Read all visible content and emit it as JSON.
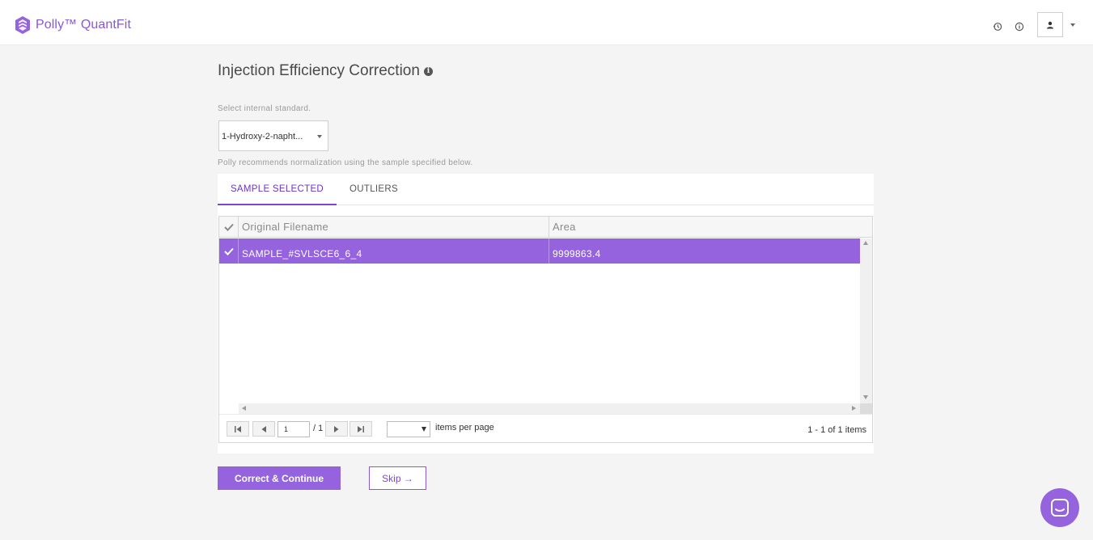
{
  "header": {
    "brand_name": "Polly™ QuantFit",
    "icons": [
      "history-icon",
      "info-icon",
      "user-icon",
      "chevron-down-icon"
    ],
    "accent_color": "#9463dd"
  },
  "page": {
    "title": "Injection Efficiency Correction",
    "title_icon": "info-icon",
    "select_label": "Select internal standard.",
    "selected_standard": "1-Hydroxy-2-napht...",
    "recommendation_text": "Polly recommends normalization using the sample specified below."
  },
  "tabs": [
    {
      "label": "SAMPLE SELECTED",
      "active": true
    },
    {
      "label": "OUTLIERS",
      "active": false
    }
  ],
  "grid": {
    "columns": [
      "Original Filename",
      "Area"
    ],
    "rows": [
      {
        "selected": true,
        "filename": "SAMPLE_#SVLSCE6_6_4",
        "area": "9999863.4"
      }
    ]
  },
  "pager": {
    "current_page": "1",
    "total_pages": "/ 1",
    "per_page_label": "items per page",
    "items_info": "1 - 1 of 1 items"
  },
  "actions": {
    "primary_label": "Correct & Continue",
    "secondary_label": "Skip →"
  }
}
